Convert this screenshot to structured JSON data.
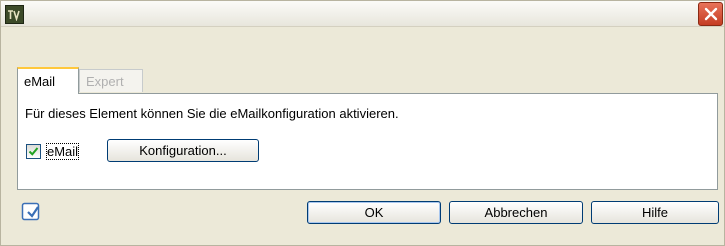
{
  "window": {
    "icon": "app-logo-icon",
    "close_icon": "close-icon"
  },
  "tabs": [
    {
      "label": "eMail",
      "active": true
    },
    {
      "label": "Expert",
      "active": false
    }
  ],
  "panel": {
    "info_text": "Für dieses Element können Sie die eMailkonfiguration aktivieren.",
    "email_checkbox": {
      "label": "eMail",
      "checked": true
    },
    "config_button": "Konfiguration..."
  },
  "footer": {
    "icon": "note-check-icon",
    "ok_button": "OK",
    "cancel_button": "Abbrechen",
    "help_button": "Hilfe"
  },
  "colors": {
    "dialog_bg": "#ece9d8",
    "close_button": "#c53d23",
    "active_tab_accent": "#ffc83c",
    "button_border": "#003c74"
  }
}
